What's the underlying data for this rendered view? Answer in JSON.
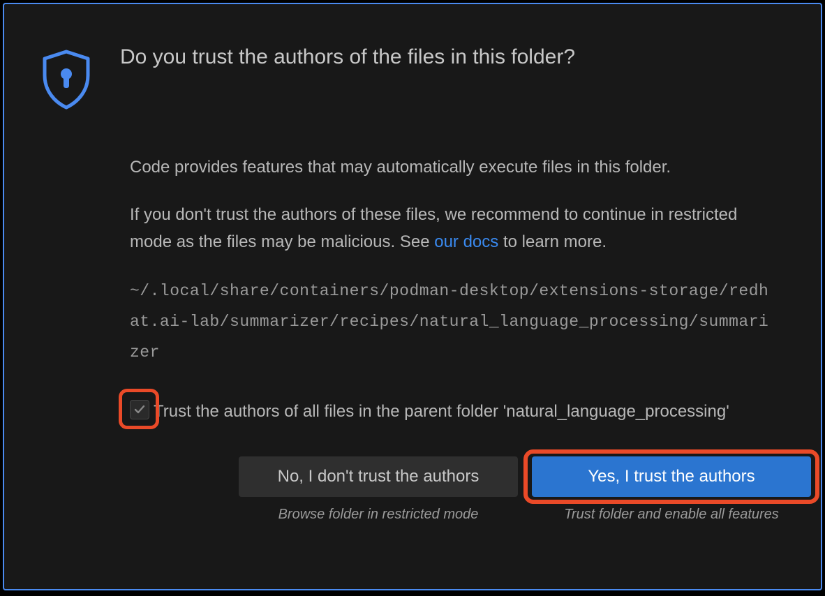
{
  "title": "Do you trust the authors of the files in this folder?",
  "paragraph1": "Code provides features that may automatically execute files in this folder.",
  "paragraph2_prefix": "If you don't trust the authors of these files, we recommend to continue in restricted mode as the files may be malicious. See ",
  "paragraph2_link": "our docs",
  "paragraph2_suffix": " to learn more.",
  "path": "~/.local/share/containers/podman-desktop/extensions-storage/redhat.ai-lab/summarizer/recipes/natural_language_processing/summarizer",
  "checkbox_label": "Trust the authors of all files in the parent folder 'natural_language_processing'",
  "buttons": {
    "no_label": "No, I don't trust the authors",
    "no_caption": "Browse folder in restricted mode",
    "yes_label": "Yes, I trust the authors",
    "yes_caption": "Trust folder and enable all features"
  }
}
